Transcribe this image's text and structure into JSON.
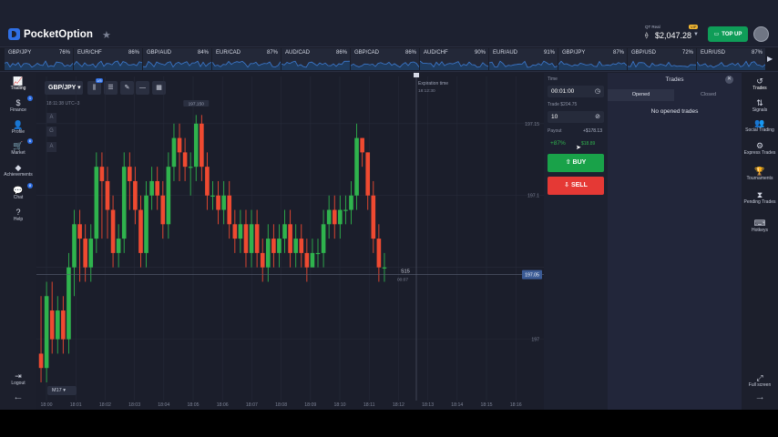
{
  "brand": {
    "name": "PocketOption"
  },
  "account": {
    "type": "QT Real",
    "balance": "$2,047.28",
    "badge": "VIP",
    "topup": "TOP UP"
  },
  "ticker": [
    {
      "name": "GBP/JPY",
      "pct": "76%",
      "icon": "pair-icon"
    },
    {
      "name": "EUR/CHF",
      "pct": "86%",
      "icon": "pair-icon"
    },
    {
      "name": "GBP/AUD",
      "pct": "84%",
      "icon": "pair-icon"
    },
    {
      "name": "EUR/CAD",
      "pct": "87%",
      "icon": "pair-icon"
    },
    {
      "name": "AUD/CAD",
      "pct": "86%",
      "icon": "pair-icon"
    },
    {
      "name": "GBP/CAD",
      "pct": "86%",
      "icon": "pair-icon"
    },
    {
      "name": "AUD/CHF",
      "pct": "90%",
      "icon": "pair-icon"
    },
    {
      "name": "EUR/AUD",
      "pct": "91%",
      "icon": "pair-icon"
    },
    {
      "name": "GBP/JPY",
      "pct": "87%",
      "icon": "pair-icon"
    },
    {
      "name": "GBP/USD",
      "pct": "72%",
      "icon": "pair-icon"
    },
    {
      "name": "EUR/USD",
      "pct": "87%",
      "icon": "pair-icon"
    }
  ],
  "leftnav": [
    {
      "label": "Trading",
      "icon": "chart-icon"
    },
    {
      "label": "Finance",
      "icon": "dollar-icon",
      "badge": "1"
    },
    {
      "label": "Profile",
      "icon": "user-icon"
    },
    {
      "label": "Market",
      "icon": "cart-icon",
      "badge": "6"
    },
    {
      "label": "Achievements",
      "icon": "diamond-icon"
    },
    {
      "label": "Chat",
      "icon": "chat-icon",
      "badge": "8"
    },
    {
      "label": "Help",
      "icon": "help-icon"
    },
    {
      "label": "Logout",
      "icon": "logout-icon"
    }
  ],
  "toolbar": {
    "pair": "GBP/JPY",
    "indicator_badge": "1/5",
    "clock": "18:11:38 UTC+3",
    "timeframe": "M17",
    "side_buttons": [
      "A",
      "G",
      "A"
    ]
  },
  "chart_data": {
    "type": "candlestick",
    "current_price": "197.05",
    "timer": "S15",
    "timer_sub": "00:07",
    "high_label": "197.150",
    "expiration_label": "Expiration time",
    "expiration_time": "18:12:30",
    "y_ticks": [
      "197.15",
      "197.1",
      "197.05",
      "197"
    ],
    "x_ticks": [
      "18:00",
      "18:01",
      "18:02",
      "18:03",
      "18:04",
      "18:05",
      "18:06",
      "18:07",
      "18:08",
      "18:09",
      "18:10",
      "18:11",
      "18:12",
      "18:13",
      "18:14",
      "18:15",
      "18:16"
    ],
    "candles": [
      [
        196.99,
        196.98,
        197.03,
        196.97
      ],
      [
        196.98,
        197.03,
        197.04,
        196.97
      ],
      [
        197.02,
        197.0,
        197.04,
        196.99
      ],
      [
        197.0,
        197.02,
        197.03,
        196.99
      ],
      [
        197.02,
        197.0,
        197.03,
        196.99
      ],
      [
        197.0,
        197.05,
        197.06,
        196.99
      ],
      [
        197.05,
        197.08,
        197.09,
        197.03
      ],
      [
        197.08,
        197.07,
        197.09,
        197.04
      ],
      [
        197.07,
        197.05,
        197.08,
        197.04
      ],
      [
        197.05,
        197.07,
        197.08,
        197.04
      ],
      [
        197.07,
        197.12,
        197.13,
        197.06
      ],
      [
        197.12,
        197.11,
        197.13,
        197.07
      ],
      [
        197.11,
        197.09,
        197.12,
        197.07
      ],
      [
        197.09,
        197.06,
        197.1,
        197.05
      ],
      [
        197.06,
        197.07,
        197.08,
        197.05
      ],
      [
        197.07,
        197.12,
        197.13,
        197.06
      ],
      [
        197.12,
        197.11,
        197.13,
        197.09
      ],
      [
        197.11,
        197.09,
        197.12,
        197.08
      ],
      [
        197.09,
        197.06,
        197.1,
        197.05
      ],
      [
        197.06,
        197.1,
        197.11,
        197.05
      ],
      [
        197.1,
        197.11,
        197.12,
        197.09
      ],
      [
        197.11,
        197.1,
        197.12,
        197.09
      ],
      [
        197.1,
        197.08,
        197.11,
        197.07
      ],
      [
        197.08,
        197.12,
        197.13,
        197.07
      ],
      [
        197.12,
        197.14,
        197.15,
        197.11
      ],
      [
        197.14,
        197.13,
        197.15,
        197.11
      ],
      [
        197.13,
        197.12,
        197.14,
        197.11
      ],
      [
        197.12,
        197.12,
        197.13,
        197.1
      ],
      [
        197.12,
        197.15,
        197.156,
        197.11
      ],
      [
        197.15,
        197.12,
        197.156,
        197.11
      ],
      [
        197.12,
        197.1,
        197.13,
        197.09
      ],
      [
        197.1,
        197.1,
        197.11,
        197.09
      ],
      [
        197.1,
        197.09,
        197.11,
        197.08
      ],
      [
        197.09,
        197.1,
        197.11,
        197.08
      ],
      [
        197.1,
        197.08,
        197.11,
        197.07
      ],
      [
        197.08,
        197.07,
        197.09,
        197.06
      ],
      [
        197.07,
        197.08,
        197.09,
        197.06
      ],
      [
        197.08,
        197.06,
        197.09,
        197.05
      ],
      [
        197.06,
        197.08,
        197.09,
        197.05
      ],
      [
        197.08,
        197.06,
        197.09,
        197.05
      ],
      [
        197.06,
        197.05,
        197.07,
        197.04
      ],
      [
        197.05,
        197.07,
        197.08,
        197.04
      ],
      [
        197.07,
        197.06,
        197.08,
        197.05
      ],
      [
        197.06,
        197.07,
        197.08,
        197.05
      ],
      [
        197.07,
        197.08,
        197.09,
        197.06
      ],
      [
        197.08,
        197.06,
        197.09,
        197.05
      ],
      [
        197.06,
        197.07,
        197.08,
        197.05
      ],
      [
        197.07,
        197.06,
        197.08,
        197.05
      ],
      [
        197.06,
        197.05,
        197.07,
        197.04
      ],
      [
        197.05,
        197.06,
        197.07,
        197.05
      ],
      [
        197.06,
        197.06,
        197.07,
        197.05
      ],
      [
        197.06,
        197.08,
        197.09,
        197.05
      ],
      [
        197.08,
        197.09,
        197.1,
        197.07
      ],
      [
        197.09,
        197.08,
        197.1,
        197.07
      ],
      [
        197.08,
        197.09,
        197.1,
        197.07
      ],
      [
        197.09,
        197.09,
        197.1,
        197.08
      ],
      [
        197.09,
        197.1,
        197.11,
        197.08
      ],
      [
        197.1,
        197.14,
        197.15,
        197.09
      ],
      [
        197.14,
        197.13,
        197.14,
        197.12
      ],
      [
        197.13,
        197.1,
        197.13,
        197.09
      ],
      [
        197.1,
        197.07,
        197.11,
        197.06
      ],
      [
        197.07,
        197.05,
        197.08,
        197.04
      ],
      [
        197.05,
        197.05,
        197.06,
        197.04
      ]
    ]
  },
  "panel": {
    "time_label": "Time",
    "time_value": "00:01:00",
    "trade_label": "Trade $204.75",
    "trade_value": "10",
    "payout_label": "Payout",
    "payout_value": "+$178.13",
    "payout_pct": "+87%",
    "payout_amount": "$18.89",
    "buy": "BUY",
    "sell": "SELL"
  },
  "trades": {
    "title": "Trades",
    "tab_opened": "Opened",
    "tab_closed": "Closed",
    "empty": "No opened trades"
  },
  "rightnav": [
    {
      "label": "Trades",
      "icon": "history-icon"
    },
    {
      "label": "Signals",
      "icon": "signal-icon"
    },
    {
      "label": "Social Trading",
      "icon": "people-icon"
    },
    {
      "label": "Express Trades",
      "icon": "express-icon"
    },
    {
      "label": "Tournaments",
      "icon": "trophy-icon"
    },
    {
      "label": "Pending Trades",
      "icon": "hourglass-icon"
    },
    {
      "label": "Hotkeys",
      "icon": "keyboard-icon"
    },
    {
      "label": "Full screen",
      "icon": "fullscreen-icon"
    }
  ],
  "colors": {
    "up": "#2fb34d",
    "down": "#ef4a31",
    "buy": "#19a249",
    "sell": "#e53935",
    "accent": "#2f6fe4"
  }
}
